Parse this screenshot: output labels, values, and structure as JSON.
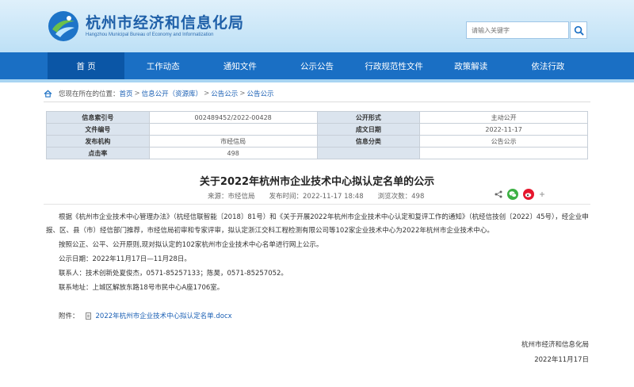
{
  "site": {
    "title": "杭州市经济和信息化局",
    "subtitle": "Hangzhou Municipal Bureau of Economy and Informatization",
    "search_placeholder": "请输入关键字"
  },
  "nav": {
    "items": [
      {
        "label": "首 页",
        "active": true
      },
      {
        "label": "工作动态"
      },
      {
        "label": "通知文件"
      },
      {
        "label": "公示公告"
      },
      {
        "label": "行政规范性文件"
      },
      {
        "label": "政策解读"
      },
      {
        "label": "依法行政"
      }
    ]
  },
  "breadcrumb": {
    "prefix": "您现在所在的位置：",
    "items": [
      "首页",
      "信息公开（资源库）",
      "公告公示",
      "公告公示"
    ],
    "separator": ">"
  },
  "info_table": {
    "rows": [
      {
        "l1": "信息索引号",
        "v1": "002489452/2022-00428",
        "l2": "公开形式",
        "v2": "主动公开"
      },
      {
        "l1": "文件编号",
        "v1": "",
        "l2": "成文日期",
        "v2": "2022-11-17"
      },
      {
        "l1": "发布机构",
        "v1": "市经信局",
        "l2": "信息分类",
        "v2": "公告公示"
      },
      {
        "l1": "点击率",
        "v1": "498",
        "l2": "",
        "v2": ""
      }
    ]
  },
  "article": {
    "title": "关于2022年杭州市企业技术中心拟认定名单的公示",
    "source": "来源：市经信局",
    "published": "发布时间：2022-11-17 18:48",
    "views": "浏览次数：498",
    "paragraphs": {
      "p1": "根据《杭州市企业技术中心管理办法》（杭经信联智能〔2018〕81号）和《关于开展2022年杭州市企业技术中心认定和复评工作的通知》（杭经信技创〔2022〕45号），经企业申报、区、县（市）经信部门推荐，市经信局初审和专家评审，拟认定浙江交科工程检测有限公司等102家企业技术中心为2022年杭州市企业技术中心。",
      "p2": "按照公正、公平、公开原则,现对拟认定的102家杭州市企业技术中心名单进行网上公示。",
      "p3": "公示日期：2022年11月17日—11月28日。",
      "p4": "联系人：技术创新处夏俊杰，0571-85257133；陈昊，0571-85257052。",
      "p5": "联系地址：上城区解放东路18号市民中心A座1706室。"
    },
    "attachment_label": "附件：",
    "attachment_name": "2022年杭州市企业技术中心拟认定名单.docx",
    "signature": "杭州市经济和信息化局",
    "date": "2022年11月17日"
  },
  "colors": {
    "nav_bg": "#1a6fc4",
    "nav_active": "#0b56a6",
    "link": "#1a5fb4",
    "table_label_bg": "#dbe4ee",
    "wechat": "#3cb043",
    "weibo": "#e6162d"
  },
  "icons": [
    "logo-emblem",
    "search-icon",
    "home-icon",
    "share-icon",
    "wechat-icon",
    "weibo-icon",
    "plus-icon",
    "document-icon"
  ]
}
